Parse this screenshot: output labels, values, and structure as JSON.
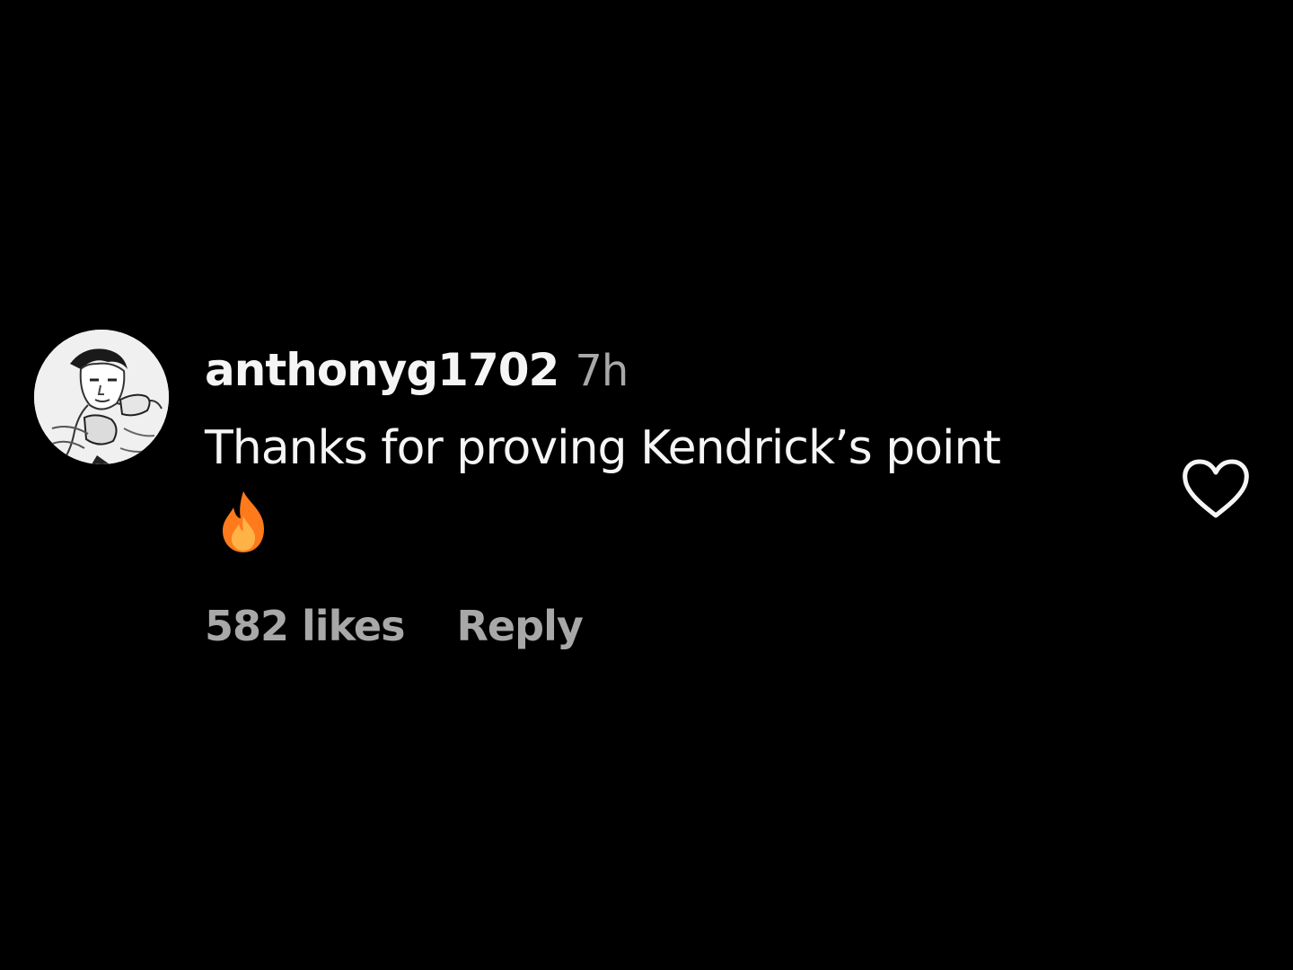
{
  "comment": {
    "username": "anthonyg1702",
    "timestamp": "7h",
    "text": "Thanks for proving Kendrick’s point",
    "emoji": "fire-emoji",
    "likes": "582 likes",
    "reply_label": "Reply"
  },
  "icons": {
    "like": "heart-outline-icon",
    "avatar": "user-avatar"
  },
  "colors": {
    "background": "#000000",
    "primary_text": "#f5f5f5",
    "secondary_text": "#a8a8a8",
    "fire_outer": "#ff7a1a",
    "fire_inner": "#ffb347"
  }
}
